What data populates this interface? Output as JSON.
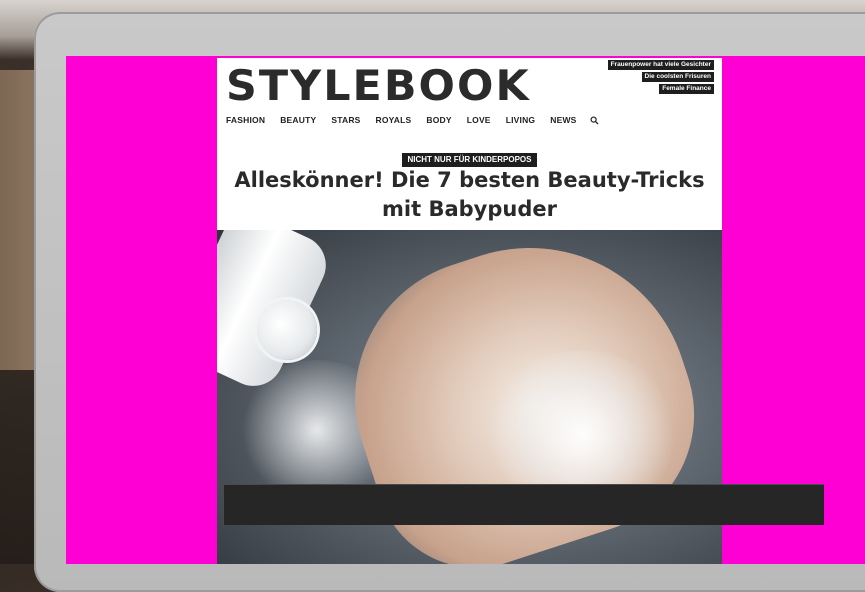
{
  "site": {
    "logo": "STYLEBOOK",
    "promos": [
      "Frauenpower hat viele Gesichter",
      "Die coolsten Frisuren",
      "Female Finance"
    ]
  },
  "nav": {
    "items": [
      "FASHION",
      "BEAUTY",
      "STARS",
      "ROYALS",
      "BODY",
      "LOVE",
      "LIVING",
      "NEWS"
    ],
    "search_icon": "search-icon"
  },
  "article": {
    "kicker": "NICHT NUR FÜR KINDERPOPOS",
    "headline_line1": "Alleskönner! Die 7 besten Beauty-Tricks",
    "headline_line2": "mit Babypuder"
  },
  "colors": {
    "screen_background": "#ff00d4",
    "text": "#2a2a2a",
    "badge": "#1e1e1e"
  }
}
